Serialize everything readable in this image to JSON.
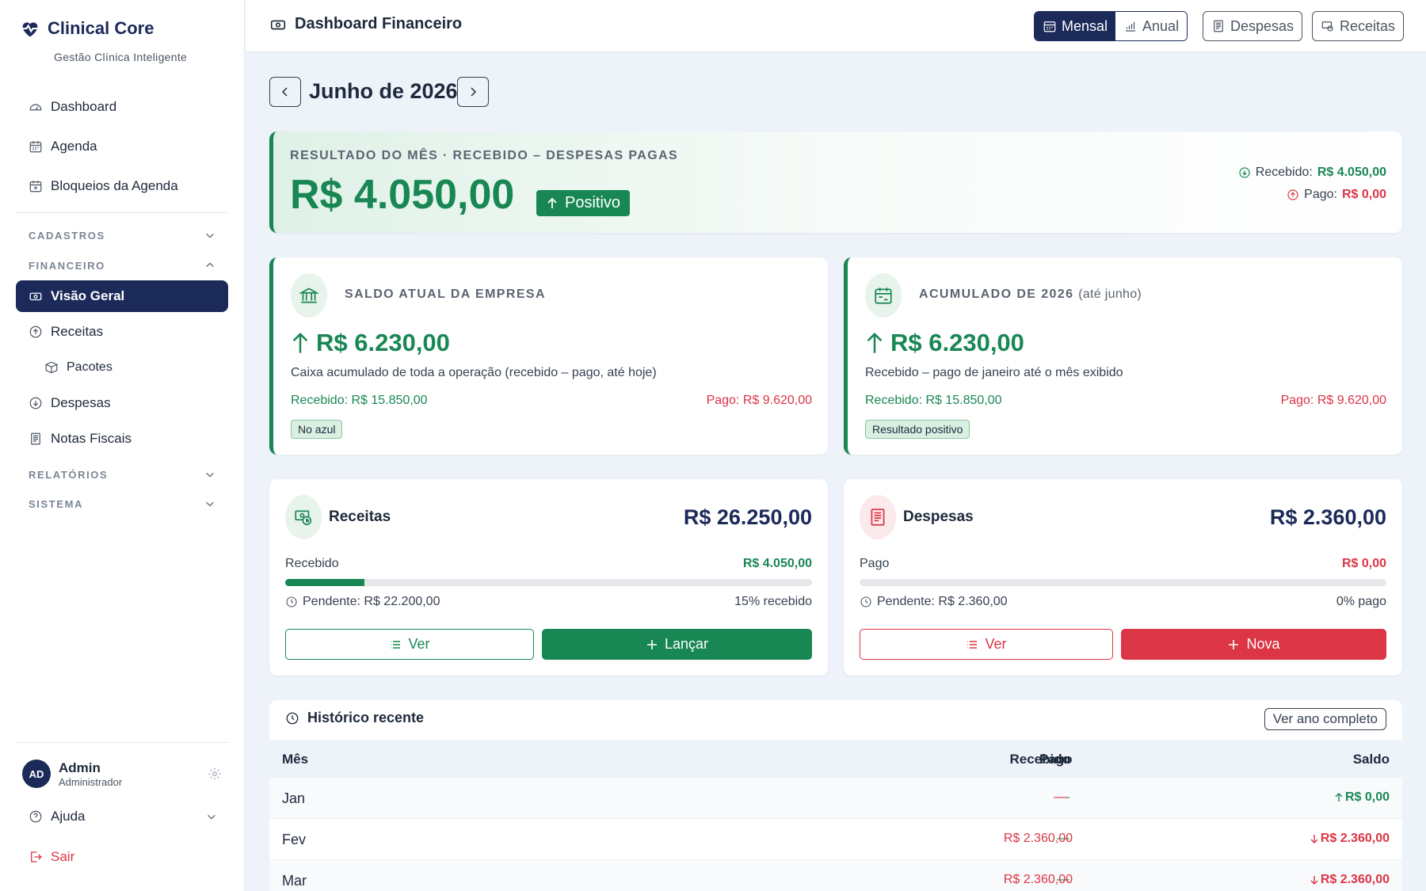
{
  "brand": {
    "name": "Clinical Core",
    "tagline": "Gestão Clínica Inteligente"
  },
  "sidebar": {
    "dashboard": "Dashboard",
    "agenda": "Agenda",
    "bloqueios": "Bloqueios da Agenda",
    "sections": {
      "cadastros": "CADASTROS",
      "financeiro": "FINANCEIRO",
      "relatorios": "RELATÓRIOS",
      "sistema": "SISTEMA"
    },
    "financeiro_items": {
      "visao": "Visão Geral",
      "receitas": "Receitas",
      "pacotes": "Pacotes",
      "despesas": "Despesas",
      "notas": "Notas Fiscais"
    },
    "user": {
      "initials": "AD",
      "name": "Admin",
      "role": "Administrador"
    },
    "ajuda": "Ajuda",
    "sair": "Sair"
  },
  "topbar": {
    "title": "Dashboard Financeiro",
    "mensal": "Mensal",
    "anual": "Anual",
    "despesas": "Despesas",
    "receitas": "Receitas"
  },
  "month": "Junho de 2026",
  "result": {
    "label": "RESULTADO DO MÊS · RECEBIDO – DESPESAS PAGAS",
    "value": "R$ 4.050,00",
    "badge": "Positivo",
    "recebido_label": "Recebido:",
    "recebido_value": "R$ 4.050,00",
    "pago_label": "Pago:",
    "pago_value": "R$ 0,00"
  },
  "saldo": {
    "label": "SALDO ATUAL DA EMPRESA",
    "value": "R$ 6.230,00",
    "desc": "Caixa acumulado de toda a operação (recebido – pago, até hoje)",
    "recebido": "Recebido: R$ 15.850,00",
    "pago": "Pago: R$ 9.620,00",
    "badge": "No azul"
  },
  "acumulado": {
    "label": "ACUMULADO DE 2026",
    "label_suffix": "(até junho)",
    "value": "R$ 6.230,00",
    "desc": "Recebido – pago de janeiro até o mês exibido",
    "recebido": "Recebido: R$ 15.850,00",
    "pago": "Pago: R$ 9.620,00",
    "badge": "Resultado positivo"
  },
  "receitas_card": {
    "title": "Receitas",
    "total": "R$ 26.250,00",
    "sub_label": "Recebido",
    "sub_value": "R$ 4.050,00",
    "progress": 0.15,
    "pendente": "Pendente: R$ 22.200,00",
    "percent": "15% recebido",
    "btn_ver": "Ver",
    "btn_action": "Lançar"
  },
  "despesas_card": {
    "title": "Despesas",
    "total": "R$ 2.360,00",
    "sub_label": "Pago",
    "sub_value": "R$ 0,00",
    "progress": 0,
    "pendente": "Pendente: R$ 2.360,00",
    "percent": "0% pago",
    "btn_ver": "Ver",
    "btn_action": "Nova"
  },
  "history": {
    "title": "Histórico recente",
    "button": "Ver ano completo",
    "headers": {
      "mes": "Mês",
      "recebido": "Recebido",
      "pago": "Pago",
      "saldo": "Saldo"
    },
    "rows": [
      {
        "mes": "Jan",
        "recebido": "—",
        "pago": "—",
        "saldo": "R$ 0,00"
      },
      {
        "mes": "Fev",
        "recebido": "—",
        "pago": "R$ 2.360,00",
        "saldo": "R$ 2.360,00"
      },
      {
        "mes": "Mar",
        "recebido": "—",
        "pago": "R$ 2.360,00",
        "saldo": "R$ 2.360,00"
      }
    ]
  },
  "colors": {
    "navy": "#1c2a5a",
    "green": "#198754",
    "red": "#dc3545",
    "background": "#eef3fa"
  }
}
